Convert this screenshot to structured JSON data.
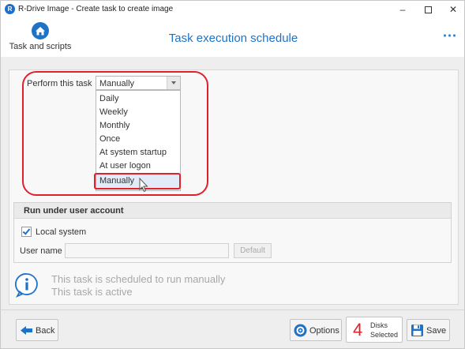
{
  "window": {
    "title": "R-Drive Image - Create task to create image",
    "minimize_glyph": "–",
    "close_glyph": "✕"
  },
  "header": {
    "home_label": "Task and scripts",
    "home_icon": "home-icon",
    "title": "Task execution schedule",
    "more_glyph": "⋯"
  },
  "schedule": {
    "label": "Perform this task",
    "selected": "Manually",
    "options": [
      "Daily",
      "Weekly",
      "Monthly",
      "Once",
      "At system startup",
      "At user logon",
      "Manually"
    ]
  },
  "account": {
    "title": "Run under user account",
    "local_system_label": "Local system",
    "local_system_checked": true,
    "username_label": "User name",
    "username_value": "",
    "default_label": "Default"
  },
  "info": {
    "line1": "This task is scheduled to run manually",
    "line2": "This task is active"
  },
  "footer": {
    "back_label": "Back",
    "options_label": "Options",
    "disks_count": "4",
    "disks_label_top": "Disks",
    "disks_label_bottom": "Selected",
    "save_label": "Save"
  },
  "colors": {
    "accent": "#1f73c6",
    "highlight_outline": "#e0202a"
  }
}
